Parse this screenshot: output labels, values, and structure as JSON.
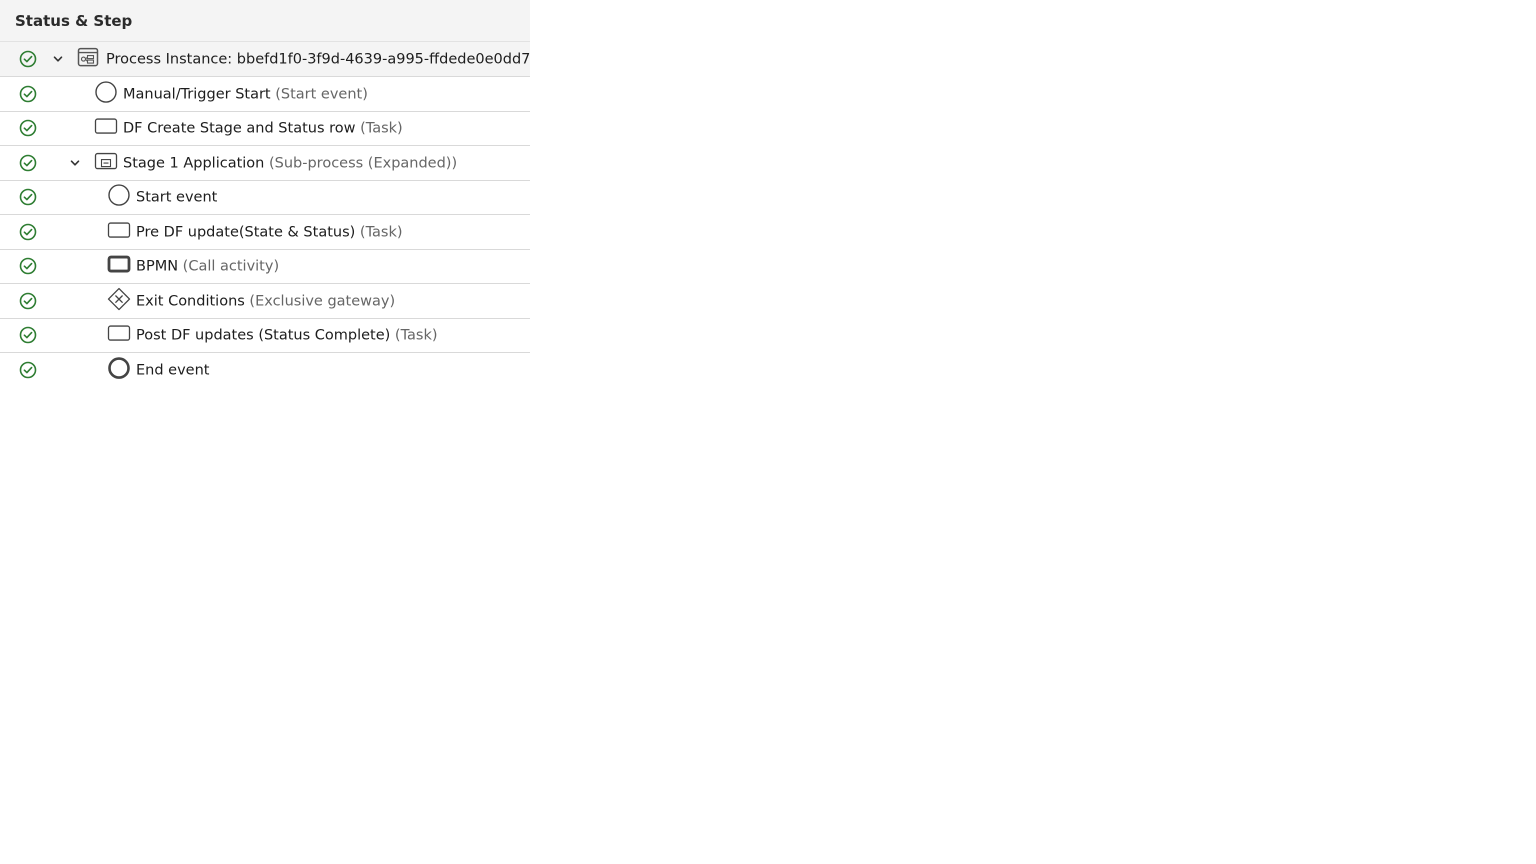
{
  "header": {
    "title": "Status & Step"
  },
  "colors": {
    "success": "#2e7d32",
    "icon": "#555555"
  },
  "rows": [
    {
      "name": "Process Instance: bbefd1f0-3f9d-4639-a995-ffdede0e0dd7",
      "type": "",
      "status_icon": "check-circle-icon",
      "node_icon": "process-instance-icon",
      "expandable": true
    },
    {
      "name": "Manual/Trigger Start",
      "type": " (Start event)",
      "status_icon": "check-circle-icon",
      "node_icon": "start-event-icon"
    },
    {
      "name": "DF Create Stage and Status row",
      "type": " (Task)",
      "status_icon": "check-circle-icon",
      "node_icon": "task-icon"
    },
    {
      "name": "Stage 1 Application",
      "type": " (Sub-process (Expanded))",
      "status_icon": "check-circle-icon",
      "node_icon": "subprocess-icon",
      "expandable": true
    },
    {
      "name": "Start event",
      "type": "",
      "status_icon": "check-circle-icon",
      "node_icon": "start-event-icon"
    },
    {
      "name": "Pre DF update(State & Status)",
      "type": " (Task)",
      "status_icon": "check-circle-icon",
      "node_icon": "task-icon"
    },
    {
      "name": "BPMN",
      "type": " (Call activity)",
      "status_icon": "check-circle-icon",
      "node_icon": "call-activity-icon"
    },
    {
      "name": "Exit Conditions",
      "type": " (Exclusive gateway)",
      "status_icon": "check-circle-icon",
      "node_icon": "exclusive-gateway-icon"
    },
    {
      "name": "Post DF updates (Status Complete)",
      "type": " (Task)",
      "status_icon": "check-circle-icon",
      "node_icon": "task-icon"
    },
    {
      "name": "End event",
      "type": "",
      "status_icon": "check-circle-icon",
      "node_icon": "end-event-icon"
    }
  ]
}
